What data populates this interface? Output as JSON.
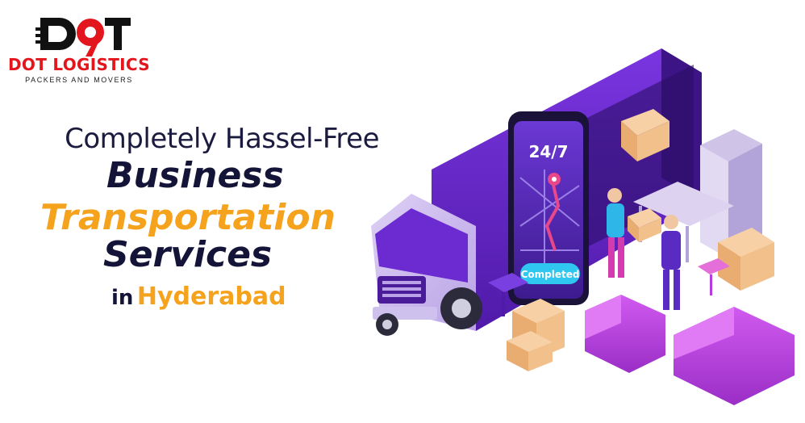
{
  "brand": {
    "logo_mark": "D9T",
    "name": "DOT LOGISTICS",
    "tagline": "PACKERS AND MOVERS",
    "colors": {
      "red": "#e3151d",
      "dark": "#1a1a1a"
    }
  },
  "headline": {
    "line1": "Completely Hassel-Free",
    "line2": "Business",
    "line3": "Transportation",
    "line4": "Services",
    "prefix": "in",
    "city": "Hyderabad"
  },
  "phone": {
    "header": "24/7",
    "status": "Completed"
  },
  "colors": {
    "navy": "#141438",
    "orange": "#f5a21c",
    "purple": "#6b2bd1",
    "magenta": "#b63ce0"
  },
  "icons": [
    "location-pin-icon",
    "truck-illustration",
    "phone-illustration",
    "box-illustration",
    "sofa-illustration",
    "chair-illustration",
    "wardrobe-illustration"
  ]
}
